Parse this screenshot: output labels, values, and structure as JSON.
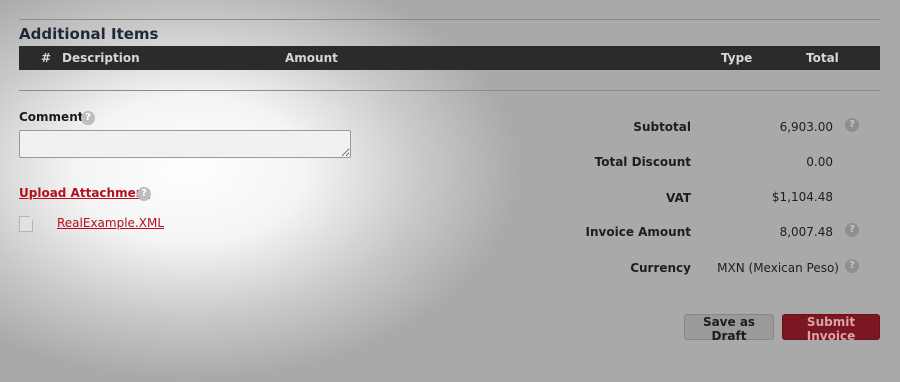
{
  "additional_items": {
    "title": "Additional Items",
    "columns": [
      "#",
      "Description",
      "Amount",
      "Type",
      "Total"
    ]
  },
  "comment": {
    "label": "Comment",
    "value": ""
  },
  "attachment": {
    "upload_label": "Upload Attachment",
    "file_name": "RealExample.XML"
  },
  "summary": {
    "subtotal_label": "Subtotal",
    "subtotal_value": "6,903.00",
    "discount_label": "Total Discount",
    "discount_value": "0.00",
    "vat_label": "VAT",
    "vat_value": "$1,104.48",
    "invoice_amount_label": "Invoice Amount",
    "invoice_amount_value": "8,007.48",
    "currency_label": "Currency",
    "currency_value": "MXN (Mexican Peso)"
  },
  "actions": {
    "save_draft": "Save as Draft",
    "submit": "Submit Invoice"
  },
  "help_glyph": "?"
}
